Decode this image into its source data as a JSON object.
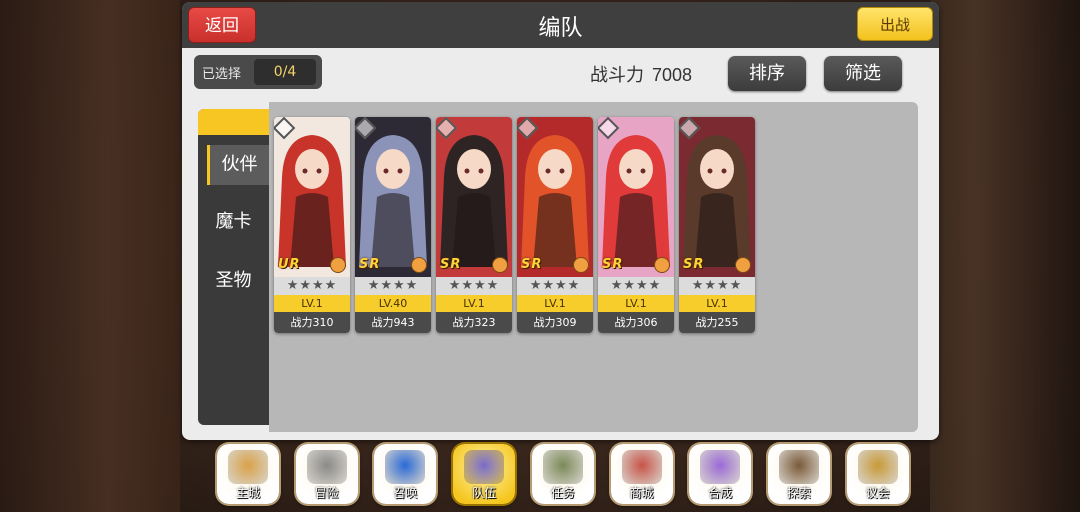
{
  "header": {
    "title": "编队",
    "back_label": "返回",
    "battle_label": "出战"
  },
  "selection": {
    "label": "已选择",
    "value": "0/4"
  },
  "power": {
    "label": "战斗力",
    "value": "7008"
  },
  "actions": {
    "sort_label": "排序",
    "filter_label": "筛选"
  },
  "side_tabs": [
    {
      "label": "伙伴",
      "active": true
    },
    {
      "label": "魔卡",
      "active": false
    },
    {
      "label": "圣物",
      "active": false
    }
  ],
  "cards": [
    {
      "rarity": "UR",
      "stars": "★★★★",
      "level": "LV.1",
      "power": "战力310",
      "hair_color": "#c8342a",
      "bg_color": "#f2e8e0"
    },
    {
      "rarity": "SR",
      "stars": "★★★★",
      "level": "LV.40",
      "power": "战力943",
      "hair_color": "#8b93b8",
      "bg_color": "#2d2a36"
    },
    {
      "rarity": "SR",
      "stars": "★★★★",
      "level": "LV.1",
      "power": "战力323",
      "hair_color": "#2f2424",
      "bg_color": "#c33a3a"
    },
    {
      "rarity": "SR",
      "stars": "★★★★",
      "level": "LV.1",
      "power": "战力309",
      "hair_color": "#e2532a",
      "bg_color": "#b42a2a"
    },
    {
      "rarity": "SR",
      "stars": "★★★★",
      "level": "LV.1",
      "power": "战力306",
      "hair_color": "#e03a3a",
      "bg_color": "#e8a4c4"
    },
    {
      "rarity": "SR",
      "stars": "★★★★",
      "level": "LV.1",
      "power": "战力255",
      "hair_color": "#5a3a2a",
      "bg_color": "#7a2a30"
    }
  ],
  "bottom_nav": [
    {
      "label": "主城",
      "icon": "castle-icon",
      "active": false,
      "color": "#d9a24a"
    },
    {
      "label": "冒险",
      "icon": "crossed-swords-icon",
      "active": false,
      "color": "#8a8a8a"
    },
    {
      "label": "召唤",
      "icon": "summon-card-icon",
      "active": false,
      "color": "#2a6ad8"
    },
    {
      "label": "队伍",
      "icon": "team-crest-icon",
      "active": true,
      "color": "#7a6ac8"
    },
    {
      "label": "任务",
      "icon": "quest-book-icon",
      "active": false,
      "color": "#7a8a5a"
    },
    {
      "label": "商城",
      "icon": "shop-tree-icon",
      "active": false,
      "color": "#c8544a"
    },
    {
      "label": "合成",
      "icon": "crystal-icon",
      "active": false,
      "color": "#9a6ad8"
    },
    {
      "label": "探索",
      "icon": "crossbow-icon",
      "active": false,
      "color": "#7a5a3a"
    },
    {
      "label": "议会",
      "icon": "council-crown-icon",
      "active": false,
      "color": "#c89a3a"
    }
  ]
}
